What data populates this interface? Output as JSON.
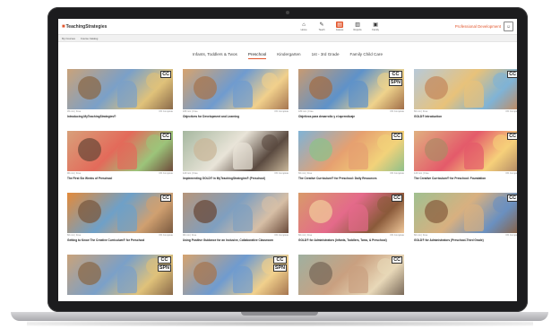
{
  "header": {
    "logo_bold": "TeachingStrategies",
    "logo_light": "",
    "nav": [
      {
        "label": "Home",
        "icon": "home-icon",
        "glyph": "⌂",
        "active": false
      },
      {
        "label": "Teach",
        "icon": "pencil-icon",
        "glyph": "✎",
        "active": false
      },
      {
        "label": "Assess",
        "icon": "clipboard-icon",
        "glyph": "▤",
        "active": true
      },
      {
        "label": "Reports",
        "icon": "bar-chart-icon",
        "glyph": "▥",
        "active": false
      },
      {
        "label": "Family",
        "icon": "family-icon",
        "glyph": "▣",
        "active": false
      }
    ],
    "product_label": "Professional Development",
    "user_glyph": "☺"
  },
  "subnav": [
    "My Courses",
    "Course Catalog"
  ],
  "tabs": [
    {
      "label": "Infants, Toddlers & Twos",
      "active": false
    },
    {
      "label": "Preschool",
      "active": true
    },
    {
      "label": "Kindergarten",
      "active": false
    },
    {
      "label": "1st - 3rd Grade",
      "active": false
    },
    {
      "label": "Family Child Care",
      "active": false
    }
  ],
  "courses": [
    {
      "title": "Introducing MyTeachingStrategies®",
      "meta_left": "45 min | Free",
      "meta_right": "0% Complete",
      "badges": [
        "CC"
      ],
      "palette": [
        "#c9a27a",
        "#7aa0c8",
        "#e0c27a",
        "#8a6a4a"
      ]
    },
    {
      "title": "Objectives for Development and Learning",
      "meta_left": "180 min | Free",
      "meta_right": "0% Complete",
      "badges": [],
      "palette": [
        "#d6a36e",
        "#6f9bcf",
        "#f1d08c",
        "#a67650"
      ]
    },
    {
      "title": "Objetivos para desarrollo y el aprendizaje",
      "meta_left": "180 min | Free",
      "meta_right": "0% Complete",
      "badges": [
        "CC",
        "SPN"
      ],
      "palette": [
        "#c79a72",
        "#5e92c9",
        "#efd38c",
        "#a06d48"
      ]
    },
    {
      "title": "GOLD® Introduction",
      "meta_left": "60 min | Free",
      "meta_right": "0% Complete",
      "badges": [
        "CC"
      ],
      "palette": [
        "#b7c9d8",
        "#e8c27a",
        "#7fb3d6",
        "#c48a5e"
      ]
    },
    {
      "title": "The First Six Weeks of Preschool",
      "meta_left": "90 min | Free",
      "meta_right": "0% Complete",
      "badges": [
        "CC"
      ],
      "palette": [
        "#d8a07a",
        "#e36a5a",
        "#9cc47a",
        "#6e4a3a"
      ]
    },
    {
      "title": "Implementing GOLD® in MyTeachingStrategies® (Preschool)",
      "meta_left": "120 min | Free",
      "meta_right": "0% Complete",
      "badges": [],
      "palette": [
        "#a6b8a0",
        "#e9e4d8",
        "#5a4a40",
        "#c9b79a"
      ]
    },
    {
      "title": "The Creative Curriculum® for Preschool: Daily Resources",
      "meta_left": "60 min | Free",
      "meta_right": "0% Complete",
      "badges": [
        "CC"
      ],
      "palette": [
        "#7fb3d6",
        "#e6a070",
        "#f2d27a",
        "#8fc08a"
      ]
    },
    {
      "title": "The Creative Curriculum® for Preschool: Foundation",
      "meta_left": "120 min | Free",
      "meta_right": "0% Complete",
      "badges": [
        "CC"
      ],
      "palette": [
        "#e0b080",
        "#e45a6a",
        "#f6d07a",
        "#b08866"
      ]
    },
    {
      "title": "Getting to Know The Creative Curriculum® for Preschool",
      "meta_left": "60 min | Free",
      "meta_right": "0% Complete",
      "badges": [
        "CC"
      ],
      "palette": [
        "#e38a3a",
        "#6ea0c8",
        "#d0a070",
        "#7a5a40"
      ]
    },
    {
      "title": "Using Positive Guidance for an Inclusive, Collaborative Classroom",
      "meta_left": "90 min | Free",
      "meta_right": "0% Complete",
      "badges": [],
      "palette": [
        "#b6957a",
        "#7f9fc0",
        "#d7bfa6",
        "#6a4a3a"
      ]
    },
    {
      "title": "GOLD® for Administrators (Infants, Toddlers, Twos, & Preschool)",
      "meta_left": "60 min | Free",
      "meta_right": "0% Complete",
      "badges": [
        "CC"
      ],
      "palette": [
        "#d89a6a",
        "#e46a8a",
        "#8a5a3a",
        "#f0c89a"
      ]
    },
    {
      "title": "GOLD® for Administrators (Preschool-Third Grade)",
      "meta_left": "60 min | Free",
      "meta_right": "0% Complete",
      "badges": [
        "CC"
      ],
      "palette": [
        "#a0c090",
        "#d8b080",
        "#6a90c0",
        "#8a6040"
      ]
    },
    {
      "title": "",
      "meta_left": "",
      "meta_right": "",
      "badges": [
        "CC",
        "SPN"
      ],
      "palette": [
        "#c9a27a",
        "#7aa0c8",
        "#e0c27a",
        "#8a6a4a"
      ],
      "partial": true
    },
    {
      "title": "",
      "meta_left": "",
      "meta_right": "",
      "badges": [
        "CC",
        "SPN"
      ],
      "palette": [
        "#d6a36e",
        "#6f9bcf",
        "#f1d08c",
        "#a67650"
      ],
      "partial": true
    },
    {
      "title": "",
      "meta_left": "",
      "meta_right": "",
      "badges": [
        "CC"
      ],
      "palette": [
        "#9fb0a0",
        "#c9a080",
        "#e8d8b8",
        "#7a6a5a"
      ],
      "partial": true
    }
  ]
}
